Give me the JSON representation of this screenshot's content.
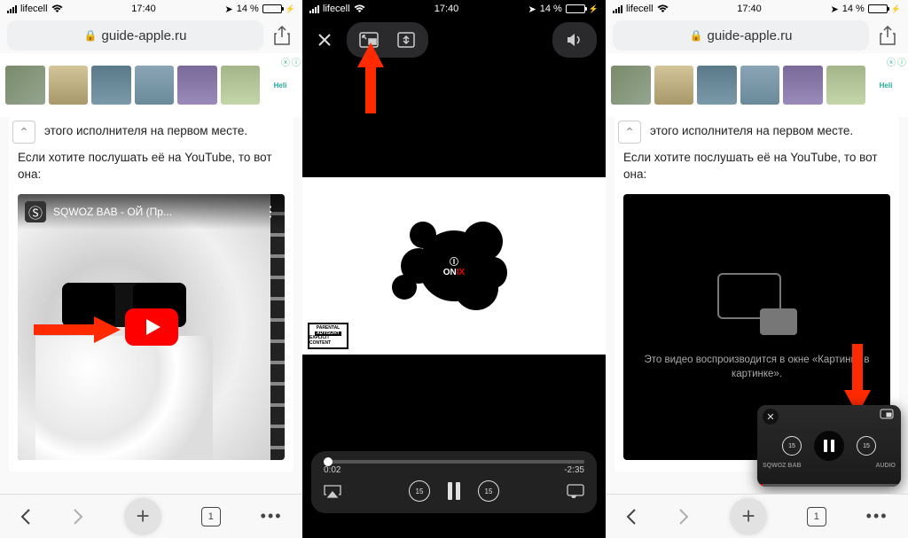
{
  "status": {
    "carrier": "lifecell",
    "time": "17:40",
    "battery_pct": "14 %",
    "wifi_icon": "wifi-icon",
    "location_icon": "location-icon",
    "charging_icon": "charging-icon"
  },
  "browser": {
    "url": "guide-apple.ru",
    "back": "‹",
    "forward": "›",
    "tabs_count": "1",
    "more": "•••"
  },
  "ad": {
    "close": "ⓧ",
    "info": "ⓘ",
    "brand": "Heli"
  },
  "article": {
    "line1": "этого исполнителя на первом месте.",
    "line2": "Если хотите послушать её на YouTube, то вот она:"
  },
  "youtube": {
    "title": "SQWOZ BAB - ОЙ (Пр...",
    "channel_logo": "Ⓢ"
  },
  "player": {
    "elapsed": "0:02",
    "remaining": "-2:35",
    "skip_amount": "15",
    "advisory_l1": "PARENTAL",
    "advisory_l2": "ADVISORY",
    "advisory_l3": "EXPLICIT CONTENT",
    "logo_text": "ONIX"
  },
  "pip": {
    "message": "Это видео воспроизводится в окне «Картинка в картинке».",
    "skip_amount": "15",
    "wm_left": "SQWOZ BAB",
    "wm_right": "AUDIO"
  }
}
